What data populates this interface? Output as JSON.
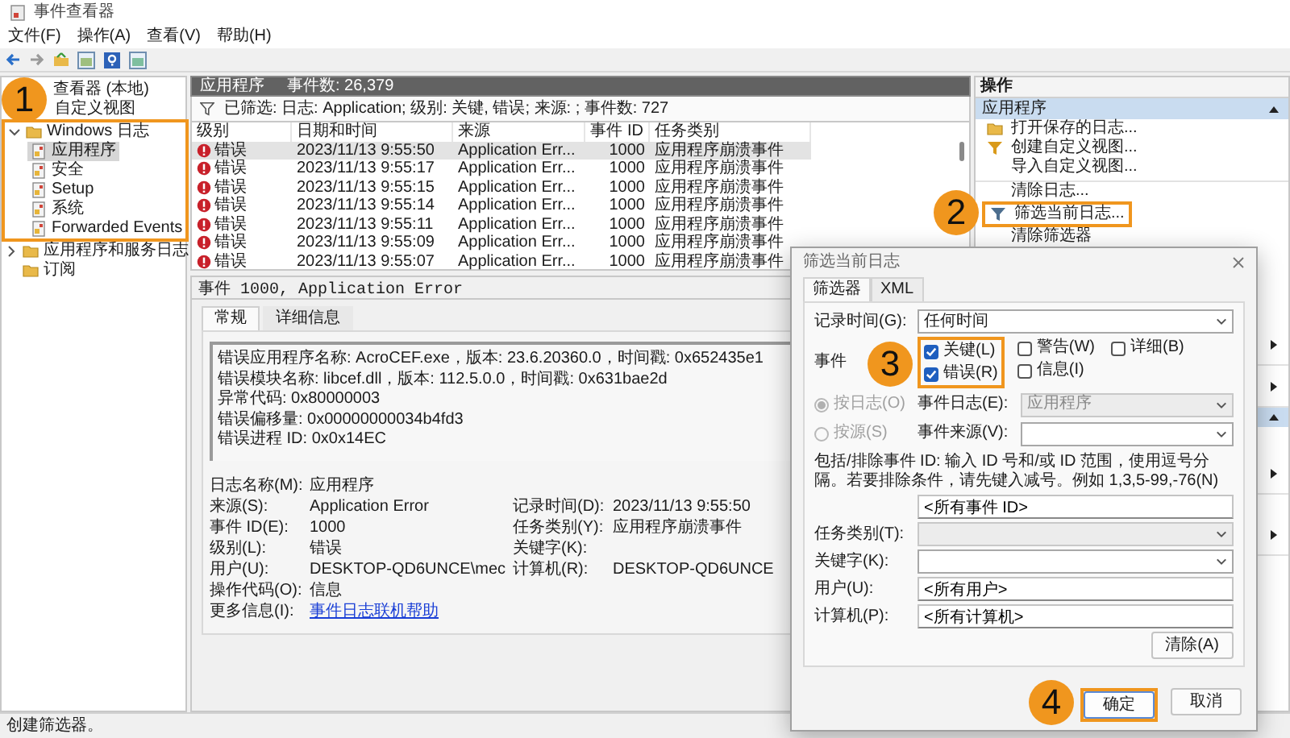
{
  "window": {
    "title": "事件查看器"
  },
  "menu": [
    "文件(F)",
    "操作(A)",
    "查看(V)",
    "帮助(H)"
  ],
  "tree": {
    "root": "查看器 (本地)",
    "items": [
      {
        "label": "自定义视图",
        "selected": false
      },
      {
        "label": "Windows 日志",
        "expanded": true,
        "selected": false,
        "callout": "1",
        "children": [
          {
            "label": "应用程序",
            "selected": true
          },
          {
            "label": "安全",
            "selected": false
          },
          {
            "label": "Setup",
            "selected": false
          },
          {
            "label": "系统",
            "selected": false
          },
          {
            "label": "Forwarded Events",
            "selected": false
          }
        ]
      },
      {
        "label": "应用程序和服务日志",
        "expanded": false,
        "selected": false
      },
      {
        "label": "订阅",
        "selected": false
      }
    ]
  },
  "log_header": {
    "title": "应用程序",
    "count": "事件数: 26,379"
  },
  "filter_summary": "已筛选: 日志: Application; 级别: 关键, 错误; 来源: ; 事件数: 727",
  "table": {
    "columns": [
      "级别",
      "日期和时间",
      "来源",
      "事件 ID",
      "任务类别"
    ],
    "rows": [
      {
        "level": "错误",
        "date": "2023/11/13 9:55:50",
        "source": "Application Err...",
        "event_id": "1000",
        "task": "应用程序崩溃事件",
        "selected": true
      },
      {
        "level": "错误",
        "date": "2023/11/13 9:55:17",
        "source": "Application Err...",
        "event_id": "1000",
        "task": "应用程序崩溃事件",
        "selected": false
      },
      {
        "level": "错误",
        "date": "2023/11/13 9:55:15",
        "source": "Application Err...",
        "event_id": "1000",
        "task": "应用程序崩溃事件",
        "selected": false
      },
      {
        "level": "错误",
        "date": "2023/11/13 9:55:14",
        "source": "Application Err...",
        "event_id": "1000",
        "task": "应用程序崩溃事件",
        "selected": false
      },
      {
        "level": "错误",
        "date": "2023/11/13 9:55:11",
        "source": "Application Err...",
        "event_id": "1000",
        "task": "应用程序崩溃事件",
        "selected": false
      },
      {
        "level": "错误",
        "date": "2023/11/13 9:55:09",
        "source": "Application Err...",
        "event_id": "1000",
        "task": "应用程序崩溃事件",
        "selected": false
      },
      {
        "level": "错误",
        "date": "2023/11/13 9:55:07",
        "source": "Application Err...",
        "event_id": "1000",
        "task": "应用程序崩溃事件",
        "selected": false
      }
    ]
  },
  "detail": {
    "title": "事件 1000, Application Error",
    "tabs": [
      {
        "label": "常规",
        "selected": true
      },
      {
        "label": "详细信息",
        "selected": false
      }
    ],
    "description": [
      "错误应用程序名称: AcroCEF.exe，版本: 23.6.20360.0，时间戳: 0x652435e1",
      "错误模块名称: libcef.dll，版本: 112.5.0.0，时间戳: 0x631bae2d",
      "异常代码: 0x80000003",
      "错误偏移量: 0x00000000034b4fd3",
      "错误进程 ID: 0x0x14EC"
    ],
    "properties": [
      [
        {
          "label": "日志名称(M):",
          "value": "应用程序",
          "kind": "text"
        }
      ],
      [
        {
          "label": "来源(S):",
          "value": "Application Error",
          "kind": "text"
        },
        {
          "label": "记录时间(D):",
          "value": "2023/11/13 9:55:50",
          "kind": "text"
        }
      ],
      [
        {
          "label": "事件 ID(E):",
          "value": "1000",
          "kind": "text"
        },
        {
          "label": "任务类别(Y):",
          "value": "应用程序崩溃事件",
          "kind": "text"
        }
      ],
      [
        {
          "label": "级别(L):",
          "value": "错误",
          "kind": "text"
        },
        {
          "label": "关键字(K):",
          "kind": "text"
        }
      ],
      [
        {
          "label": "用户(U):",
          "value": "DESKTOP-QD6UNCE\\mec",
          "kind": "text"
        },
        {
          "label": "计算机(R):",
          "value": "DESKTOP-QD6UNCE",
          "kind": "text"
        }
      ],
      [
        {
          "label": "操作代码(O):",
          "value": "信息",
          "kind": "text"
        }
      ],
      [
        {
          "label": "更多信息(I):",
          "value": "事件日志联机帮助",
          "kind": "link"
        }
      ]
    ]
  },
  "actions": {
    "title": "操作",
    "section": {
      "title": "应用程序",
      "expanded": true
    },
    "items": [
      {
        "label": "打开保存的日志...",
        "kind": "folder"
      },
      {
        "label": "创建自定义视图...",
        "kind": "new-filter"
      },
      {
        "label": "导入自定义视图...",
        "kind": "none"
      },
      {
        "label": "清除日志...",
        "kind": "none",
        "separator_before": true
      },
      {
        "label": "筛选当前日志...",
        "kind": "filter",
        "callout": "2"
      },
      {
        "label": "清除筛选器",
        "kind": "none"
      }
    ]
  },
  "dialog": {
    "title": "筛选当前日志",
    "tabs": [
      {
        "label": "筛选器",
        "selected": true
      },
      {
        "label": "XML",
        "selected": false
      }
    ],
    "logged": {
      "label": "记录时间(G):",
      "value": "任何时间"
    },
    "levels": {
      "label": "事件",
      "callout": "3",
      "columns": [
        [
          {
            "label": "关键(L)",
            "checked": true
          },
          {
            "label": "错误(R)",
            "checked": true
          }
        ],
        [
          {
            "label": "警告(W)",
            "checked": false
          },
          {
            "label": "信息(I)",
            "checked": false
          }
        ],
        [
          {
            "label": "详细(B)",
            "checked": false
          }
        ]
      ]
    },
    "sources": [
      {
        "label": "按日志(O)",
        "selected": true,
        "field_label": "事件日志(E):",
        "value": "应用程序",
        "disabled": true
      },
      {
        "label": "按源(S)",
        "selected": false,
        "field_label": "事件来源(V):",
        "disabled": false
      }
    ],
    "id_hint": "包括/排除事件 ID: 输入 ID 号和/或 ID 范围，使用逗号分隔。若要排除条件，请先键入减号。例如 1,3,5-99,-76(N)",
    "id_field": {
      "value": "<所有事件 ID>"
    },
    "task_category": {
      "label": "任务类别(T):",
      "disabled": true
    },
    "keywords": {
      "label": "关键字(K):",
      "disabled": false
    },
    "user": {
      "label": "用户(U):",
      "value": "<所有用户>"
    },
    "computer": {
      "label": "计算机(P):",
      "value": "<所有计算机>"
    },
    "clear_button": "清除(A)",
    "buttons": [
      {
        "label": "确定",
        "kind": "primary",
        "callout": "4"
      },
      {
        "label": "取消",
        "kind": "secondary"
      }
    ]
  },
  "status_bar": "创建筛选器。"
}
